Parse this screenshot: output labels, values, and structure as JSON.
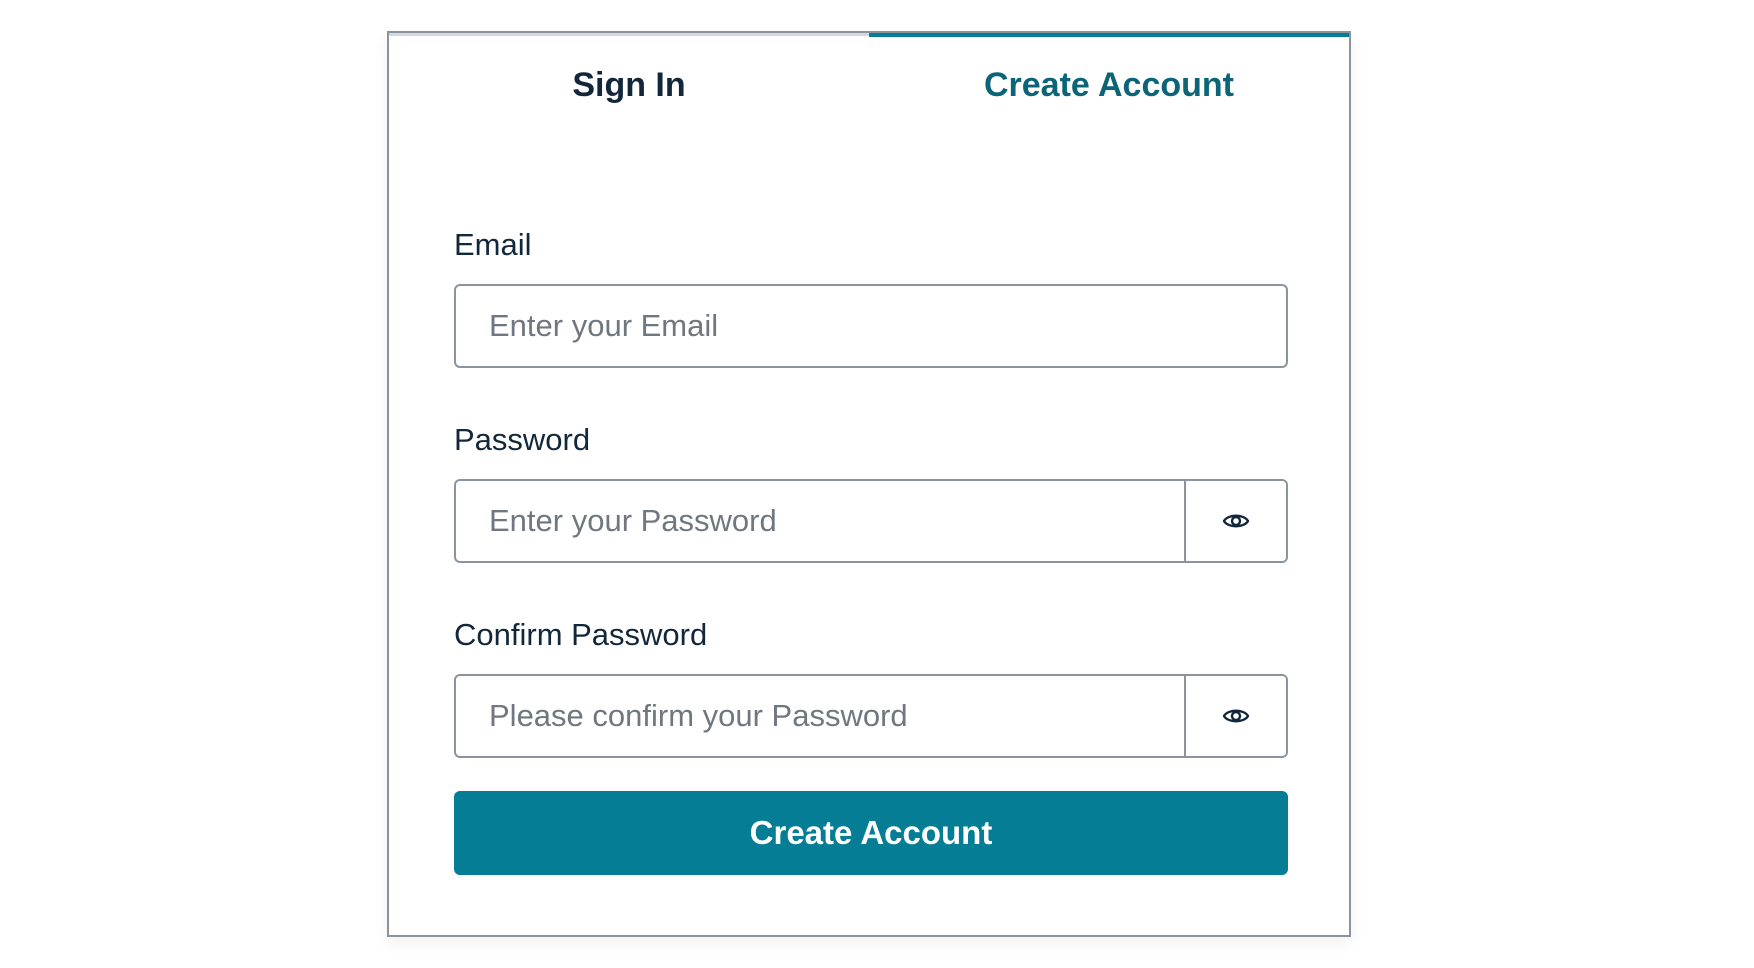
{
  "tabs": {
    "sign_in": "Sign In",
    "create_account": "Create Account",
    "active": "create_account"
  },
  "form": {
    "email": {
      "label": "Email",
      "placeholder": "Enter your Email",
      "value": ""
    },
    "password": {
      "label": "Password",
      "placeholder": "Enter your Password",
      "value": "",
      "toggle_icon": "eye-icon"
    },
    "confirm_password": {
      "label": "Confirm Password",
      "placeholder": "Please confirm your Password",
      "value": "",
      "toggle_icon": "eye-icon"
    },
    "submit_label": "Create Account"
  },
  "colors": {
    "accent": "#047d95",
    "active_tab_text": "#0b6477",
    "text": "#13273b",
    "border": "#89949f"
  }
}
